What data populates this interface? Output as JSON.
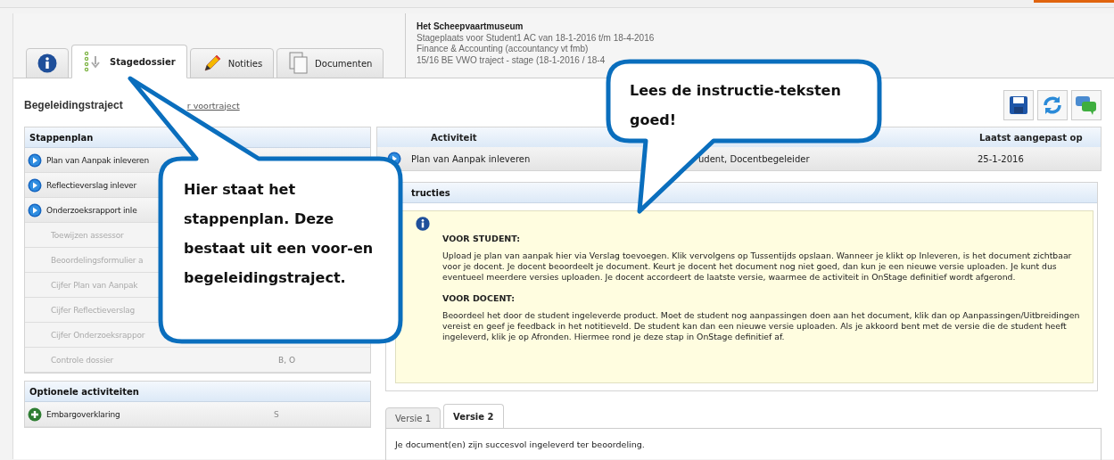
{
  "tabs": [
    {
      "kind": "info",
      "selected": false
    },
    {
      "kind": "steps",
      "label": "Stagedossier",
      "selected": true
    },
    {
      "kind": "pencil",
      "label": "Notities",
      "selected": false
    },
    {
      "kind": "documents",
      "label": "Documenten",
      "selected": false
    }
  ],
  "placement": {
    "title": "Het Scheepvaartmuseum",
    "lines": [
      "Stageplaats voor Student1 AC van 18-1-2016 t/m 18-4-2016",
      "Finance & Accounting (accountancy vt fmb)",
      "15/16 BE VWO traject - stage (18-1-2016 / 18-4"
    ]
  },
  "section_title": "Begeleidingstraject",
  "section_link": "r voortraject",
  "stappenplan": {
    "title": "Stappenplan",
    "items": [
      {
        "kind": "active",
        "label": "Plan van Aanpak inleveren"
      },
      {
        "kind": "active",
        "label": "Reflectieverslag inlever"
      },
      {
        "kind": "active",
        "label": "Onderzoeksrapport inle"
      },
      {
        "kind": "pending",
        "label": "Toewijzen assessor"
      },
      {
        "kind": "pending",
        "label": "Beoordelingsformulier a"
      },
      {
        "kind": "pending",
        "label": "Cijfer Plan van Aanpak"
      },
      {
        "kind": "pending",
        "label": "Cijfer Reflectieverslag"
      },
      {
        "kind": "pending",
        "label": "Cijfer Onderzoeksrappor"
      },
      {
        "kind": "pending",
        "label": "Controle dossier",
        "roles": "B, O"
      }
    ]
  },
  "optional": {
    "title": "Optionele activiteiten",
    "items": [
      {
        "kind": "add",
        "label": "Embargoverklaring",
        "roles": "S"
      }
    ]
  },
  "activity_table": {
    "columns": [
      "Activiteit",
      "Laatst aangepast op"
    ],
    "rows": [
      {
        "name": "Plan van Aanpak inleveren",
        "column_2": "udent, Docentbegeleider",
        "date": "25-1-2016"
      }
    ]
  },
  "instructions": {
    "title": "tructies",
    "sections": [
      {
        "heading": "VOOR STUDENT:",
        "text": "Upload je plan van aanpak hier via Verslag toevoegen. Klik vervolgens op Tussentijds opslaan. Wanneer je klikt op Inleveren, is het document zichtbaar voor je docent. Je docent beoordeelt je document. Keurt je docent het document nog niet goed, dan kun je een nieuwe versie uploaden. Je kunt dus eventueel meerdere versies uploaden. Je docent accordeert de laatste versie, waarmee de activiteit in OnStage definitief wordt afgerond."
      },
      {
        "heading": "VOOR DOCENT:",
        "text": "Beoordeel het door de student ingeleverde product. Moet de student nog aanpassingen doen aan het document, klik dan op Aanpassingen/Uitbreidingen vereist en geef je feedback in het notitieveld. De student kan dan een nieuwe versie uploaden. Als je akkoord bent met de versie die de student heeft ingeleverd, klik je op Afronden. Hiermee rond je deze stap in OnStage definitief af."
      }
    ]
  },
  "version_tabs": [
    {
      "label": "Versie 1",
      "selected": false
    },
    {
      "label": "Versie 2",
      "selected": true
    }
  ],
  "version_message": "Je document(en) zijn succesvol ingeleverd ter beoordeling.",
  "callouts": [
    {
      "kind": "left",
      "text": "Hier staat het stappenplan. Deze bestaat uit een voor-en begeleidingstraject."
    },
    {
      "kind": "right",
      "text": "Lees de instructie-teksten goed!"
    }
  ]
}
